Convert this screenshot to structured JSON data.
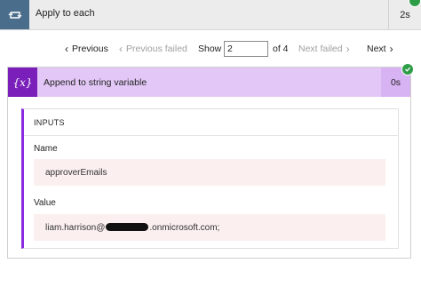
{
  "header": {
    "title": "Apply to each",
    "duration": "2s",
    "icon": "loop-icon",
    "icon_bg": "#4a6d8c",
    "status": "succeeded"
  },
  "pager": {
    "previous": "Previous",
    "previous_failed": "Previous failed",
    "show_label": "Show",
    "show_value": "2",
    "of_label": "of 4",
    "next_failed": "Next failed",
    "next": "Next"
  },
  "action": {
    "title": "Append to string variable",
    "duration": "0s",
    "icon_symbol": "{x}",
    "accent": "#7a1fba",
    "header_bg": "#e3c8f7",
    "status": "succeeded",
    "inputs_heading": "INPUTS",
    "fields": [
      {
        "label": "Name",
        "value": "approverEmails"
      },
      {
        "label": "Value",
        "value_prefix": "liam.harrison@",
        "value_suffix": ".onmicrosoft.com;"
      }
    ]
  }
}
